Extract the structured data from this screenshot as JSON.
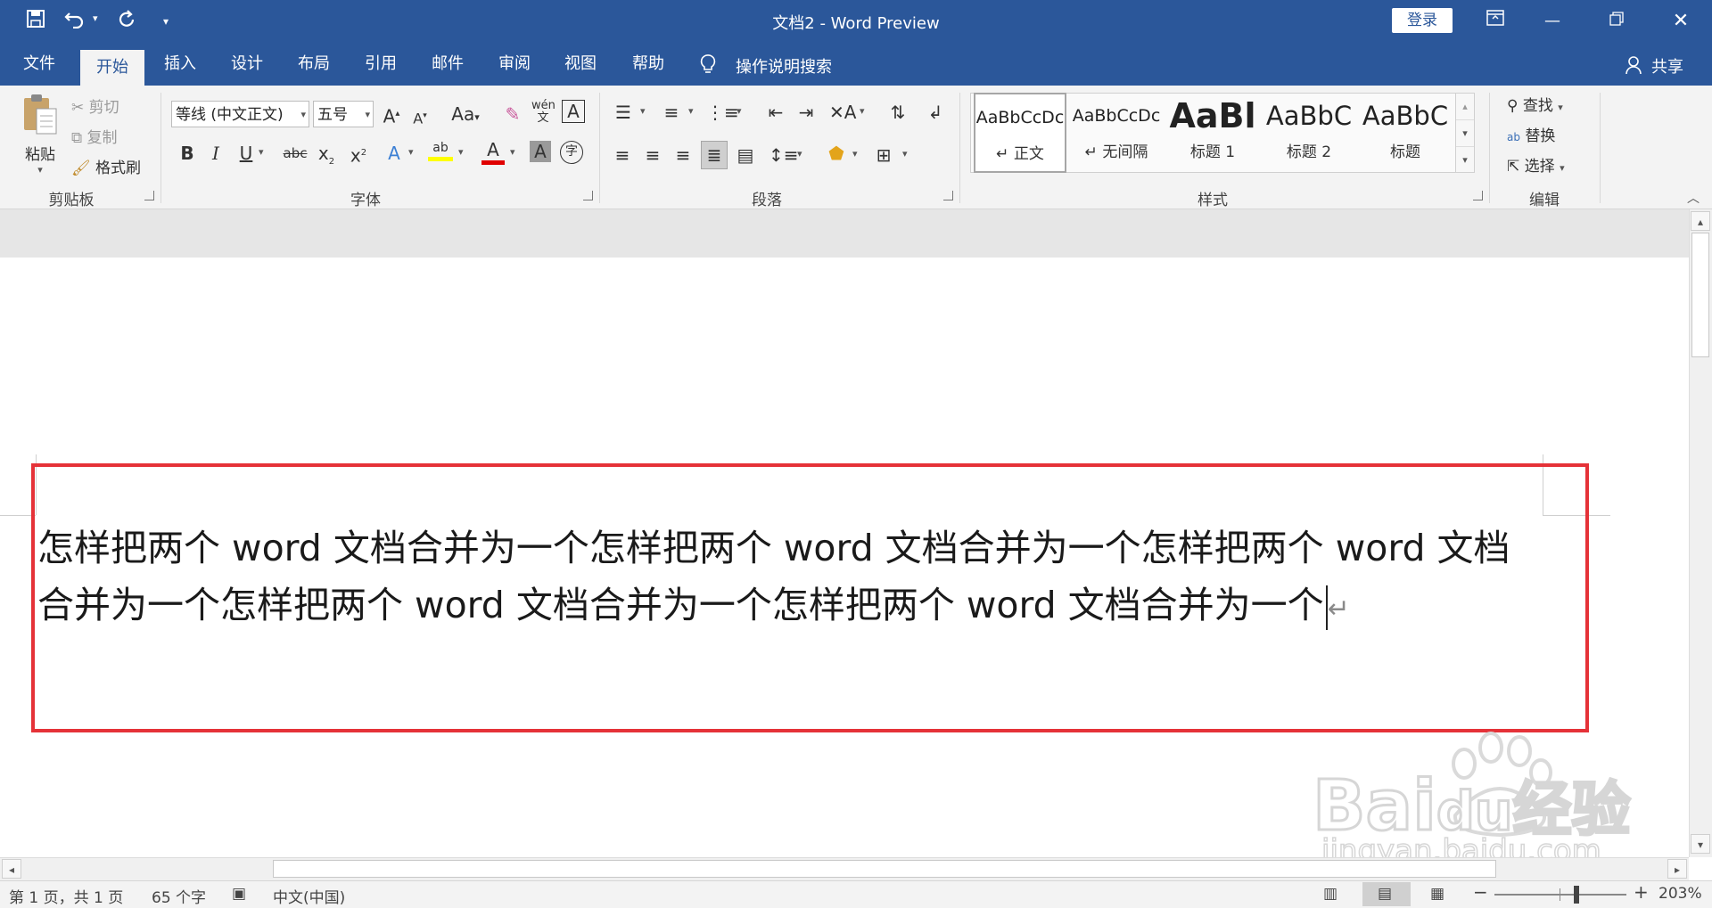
{
  "titlebar": {
    "title": "文档2  -  Word Preview",
    "login_label": "登录",
    "icons": [
      "save-icon",
      "undo-icon",
      "redo-icon",
      "customize-quick-access-icon",
      "ribbon-display-options-icon",
      "restore-icon",
      "close-icon"
    ]
  },
  "tabs": [
    "文件",
    "开始",
    "插入",
    "设计",
    "布局",
    "引用",
    "邮件",
    "审阅",
    "视图",
    "帮助"
  ],
  "active_tab": "开始",
  "tell_me": "操作说明搜索",
  "share": "共享",
  "clipboard": {
    "paste": "粘贴",
    "cut": "剪切",
    "copy": "复制",
    "format_painter": "格式刷",
    "label": "剪贴板"
  },
  "font": {
    "font_name": "等线 (中文正文)",
    "font_size": "五号",
    "bold": "B",
    "italic": "I",
    "underline": "U",
    "strike": "abc",
    "change_case": "Aa",
    "label": "字体"
  },
  "paragraph": {
    "label": "段落"
  },
  "styles": {
    "items": [
      {
        "sample": "AaBbCcDc",
        "name": "↵ 正文"
      },
      {
        "sample": "AaBbCcDc",
        "name": "↵ 无间隔"
      },
      {
        "sample": "AaBl",
        "name": "标题 1"
      },
      {
        "sample": "AaBbC",
        "name": "标题 2"
      },
      {
        "sample": "AaBbC",
        "name": "标题"
      }
    ],
    "label": "样式"
  },
  "editing": {
    "find": "查找",
    "replace": "替换",
    "select": "选择",
    "label": "编辑"
  },
  "document": {
    "line1": "怎样把两个 word 文档合并为一个怎样把两个 word 文档合并为一个怎样把两个 word 文档",
    "line2": "合并为一个怎样把两个 word 文档合并为一个怎样把两个 word 文档合并为一个"
  },
  "status": {
    "page": "第 1 页，共 1 页",
    "words": "65 个字",
    "language": "中文(中国)",
    "zoom": "203%"
  },
  "watermark": {
    "brand": "Bai",
    "brand2": "du",
    "cn": "经验",
    "url": "jingyan.baidu.com"
  },
  "colors": {
    "accent": "#2b579a",
    "highlight_red": "#e53238",
    "highlight_yellow": "#ffff00",
    "font_red": "#e00000"
  }
}
